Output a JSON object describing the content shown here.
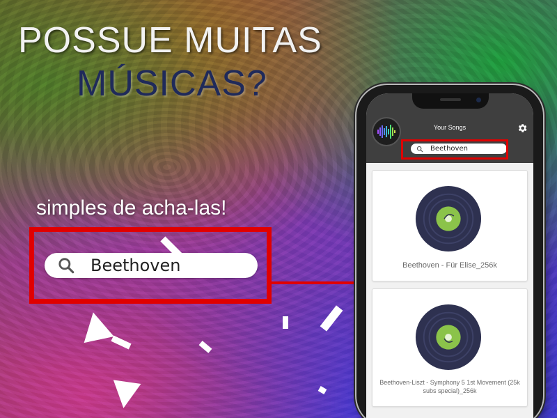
{
  "banner": {
    "headline_line1": "POSSUE MUITAS",
    "headline_line2": "MÚSICAS?",
    "tagline": "simples de acha-las!",
    "search_value": "Beethoven"
  },
  "app": {
    "title": "Your Songs",
    "search_value": "Beethoven",
    "settings_icon": "gear-icon",
    "logo_icon": "sound-wave-icon",
    "songs": [
      {
        "title": "Beethoven - Für Elise_256k"
      },
      {
        "title": "Beethoven-Liszt - Symphony 5 1st Movement (25k subs special)_256k"
      }
    ]
  },
  "colors": {
    "highlight": "#e00000",
    "headline_light": "#f2f2f2",
    "headline_dark": "#1f2a5a",
    "app_header": "#3f3f3f",
    "vinyl_label": "#8bc34a",
    "vinyl_disc": "#2e3150"
  }
}
